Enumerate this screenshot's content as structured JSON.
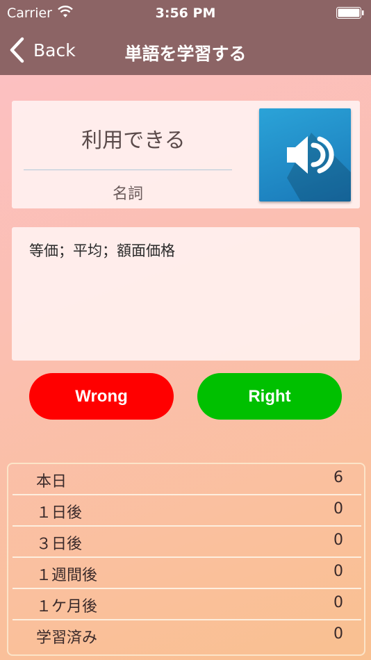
{
  "status_bar": {
    "carrier": "Carrier",
    "time": "3:56 PM"
  },
  "nav": {
    "back_label": "Back",
    "title": "単語を学習する"
  },
  "word_card": {
    "word": "利用できる",
    "part_of_speech": "名詞"
  },
  "meaning": "等価；平均；額面価格",
  "buttons": {
    "wrong": "Wrong",
    "right": "Right"
  },
  "stats": [
    {
      "label": "本日",
      "value": "6"
    },
    {
      "label": "１日後",
      "value": "0"
    },
    {
      "label": "３日後",
      "value": "0"
    },
    {
      "label": "１週間後",
      "value": "0"
    },
    {
      "label": "１ケ月後",
      "value": "0"
    },
    {
      "label": "学習済み",
      "value": "0"
    }
  ],
  "colors": {
    "nav": "#8c6465",
    "wrong": "#ff0000",
    "right": "#00c000",
    "speaker": "#1f8cc8"
  },
  "icons": [
    "wifi-icon",
    "battery-icon",
    "chevron-left-icon",
    "speaker-icon"
  ]
}
